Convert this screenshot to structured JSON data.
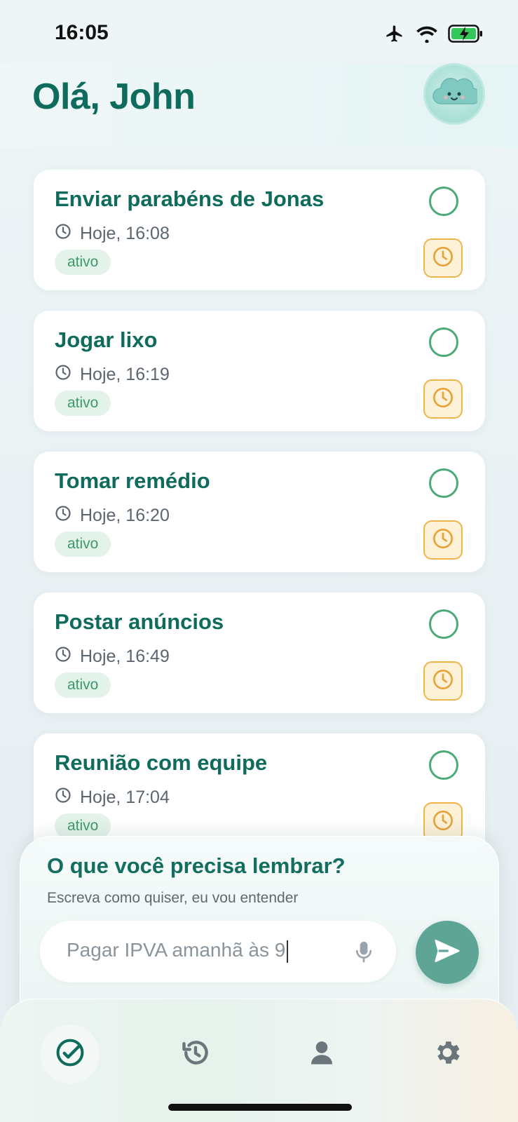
{
  "status_bar": {
    "time": "16:05",
    "icons": [
      "airplane-icon",
      "wifi-icon",
      "battery-charging-icon"
    ],
    "battery_color": "#34c759"
  },
  "header": {
    "greeting": "Olá, John",
    "avatar_icon": "cloud-mascot-icon"
  },
  "reminders": [
    {
      "title": "Enviar parabéns de Jonas",
      "time": "Hoje, 16:08",
      "status": "ativo"
    },
    {
      "title": "Jogar lixo",
      "time": "Hoje, 16:19",
      "status": "ativo"
    },
    {
      "title": "Tomar remédio",
      "time": "Hoje, 16:20",
      "status": "ativo"
    },
    {
      "title": "Postar anúncios",
      "time": "Hoje, 16:49",
      "status": "ativo"
    },
    {
      "title": "Reunião com equipe",
      "time": "Hoje, 17:04",
      "status": "ativo"
    }
  ],
  "composer": {
    "title": "O que você precisa lembrar?",
    "subtitle": "Escreva como quiser, eu vou entender",
    "input_value": "Pagar IPVA amanhã às 9"
  },
  "bottom_nav": {
    "items": [
      "check-circle-icon",
      "history-icon",
      "person-icon",
      "gear-icon"
    ],
    "active_index": 0
  },
  "colors": {
    "primary": "#0f6b5c",
    "accent_green": "#4caa78",
    "snooze_orange": "#f0b54a",
    "send_button": "#5fa596"
  }
}
